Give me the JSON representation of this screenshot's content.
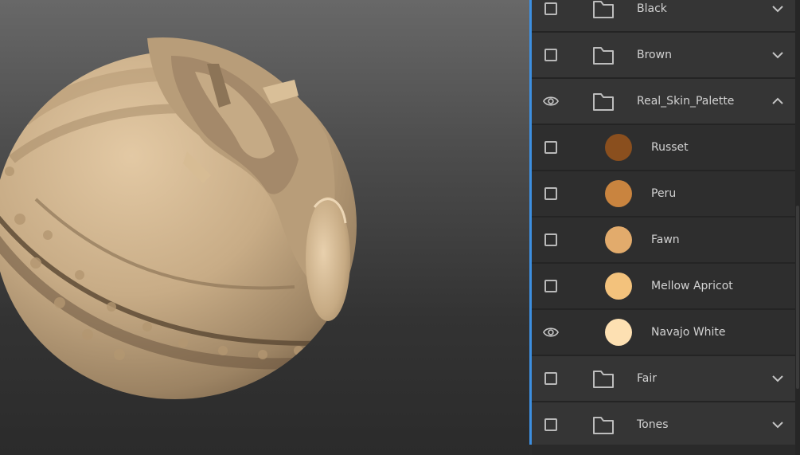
{
  "viewport": {
    "object": "sculpted sphere",
    "background_top": "#686868",
    "background_bottom": "#2b2b2b"
  },
  "accent_color": "#3d8fe0",
  "layers": [
    {
      "kind": "group",
      "label": "Black",
      "visible": false,
      "expanded": false
    },
    {
      "kind": "group",
      "label": "Brown",
      "visible": false,
      "expanded": false
    },
    {
      "kind": "group",
      "label": "Real_Skin_Palette",
      "visible": true,
      "expanded": true
    },
    {
      "kind": "item",
      "label": "Russet",
      "color": "#8a4f1e",
      "visible": false
    },
    {
      "kind": "item",
      "label": "Peru",
      "color": "#c9843f",
      "visible": false
    },
    {
      "kind": "item",
      "label": "Fawn",
      "color": "#e2ab6c",
      "visible": false
    },
    {
      "kind": "item",
      "label": "Mellow Apricot",
      "color": "#f3c27c",
      "visible": false
    },
    {
      "kind": "item",
      "label": "Navajo White",
      "color": "#fde0b2",
      "visible": true
    },
    {
      "kind": "group",
      "label": "Fair",
      "visible": false,
      "expanded": false
    },
    {
      "kind": "group",
      "label": "Tones",
      "visible": false,
      "expanded": false
    }
  ]
}
